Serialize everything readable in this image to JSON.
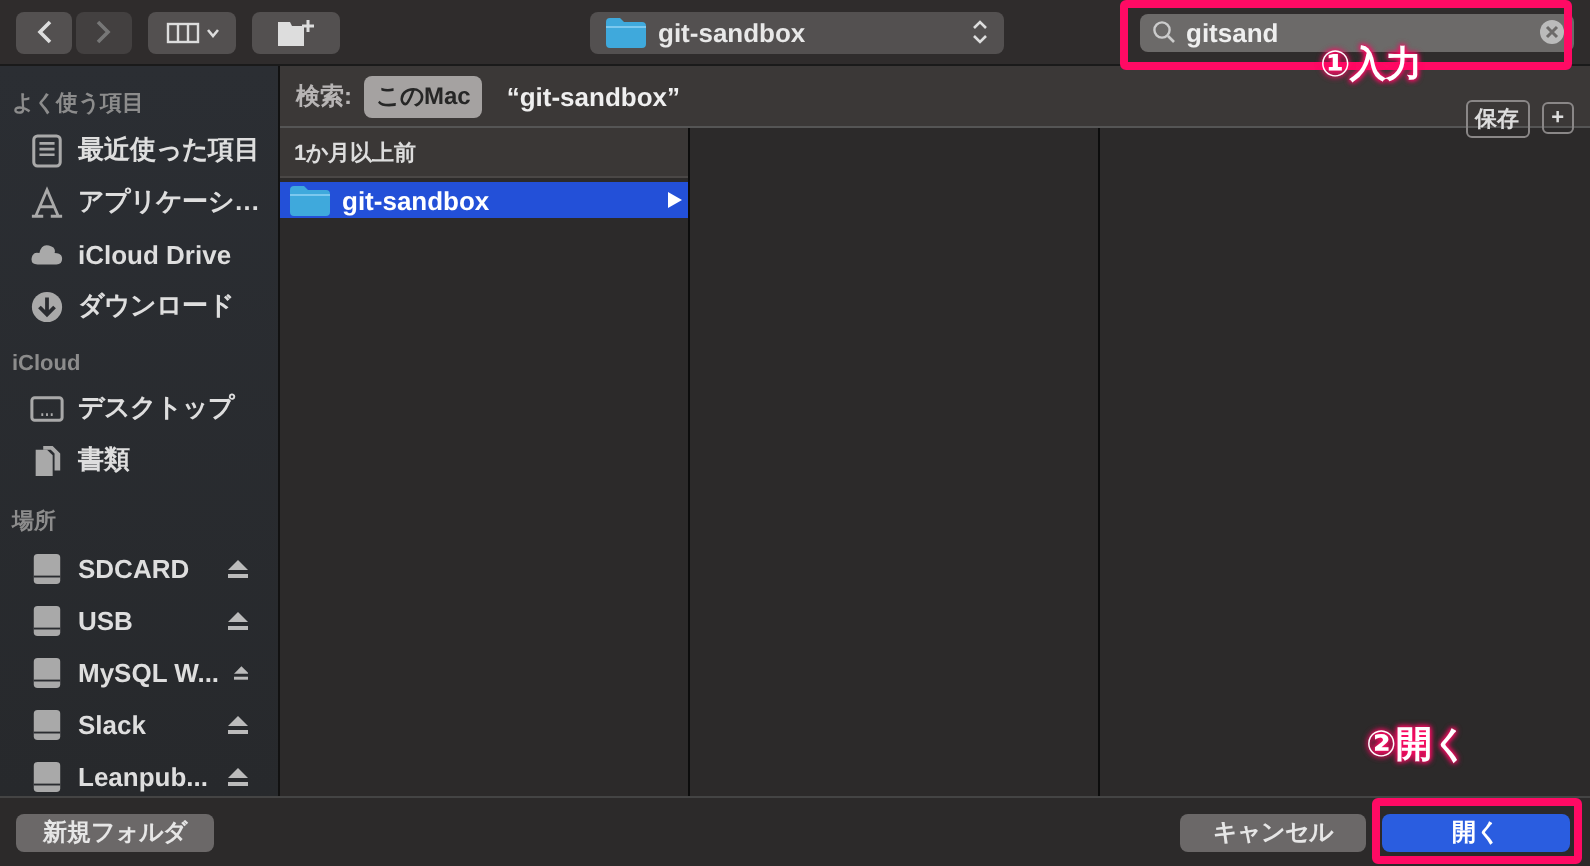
{
  "toolbar": {
    "path_popup": {
      "label": "git-sandbox"
    },
    "search": {
      "value": "gitsand"
    }
  },
  "search_scope": {
    "label": "検索:",
    "scopes": [
      {
        "label": "このMac",
        "selected": true
      },
      {
        "label": "“git-sandbox”",
        "selected": false
      }
    ],
    "save_button": "保存",
    "add_button": "+"
  },
  "sidebar": {
    "sections": [
      {
        "title": "よく使う項目",
        "items": [
          {
            "label": "最近使った項目",
            "kind": "recents"
          },
          {
            "label": "アプリケーシ…",
            "kind": "apps"
          },
          {
            "label": "iCloud Drive",
            "kind": "cloud"
          },
          {
            "label": "ダウンロード",
            "kind": "download"
          }
        ]
      },
      {
        "title": "iCloud",
        "items": [
          {
            "label": "デスクトップ",
            "kind": "desktop"
          },
          {
            "label": "書類",
            "kind": "documents"
          }
        ]
      },
      {
        "title": "場所",
        "items": [
          {
            "label": "SDCARD",
            "kind": "drive"
          },
          {
            "label": "USB",
            "kind": "drive"
          },
          {
            "label": "MySQL W...",
            "kind": "drive"
          },
          {
            "label": "Slack",
            "kind": "drive"
          },
          {
            "label": "Leanpub...",
            "kind": "drive"
          }
        ]
      }
    ]
  },
  "browser": {
    "group": "1か月以上前",
    "items": [
      {
        "label": "git-sandbox",
        "selected": true
      }
    ]
  },
  "footer": {
    "new_folder": "新規フォルダ",
    "cancel": "キャンセル",
    "open": "開く"
  },
  "annotations": [
    {
      "label": "①入力"
    },
    {
      "label": "②開く"
    }
  ]
}
